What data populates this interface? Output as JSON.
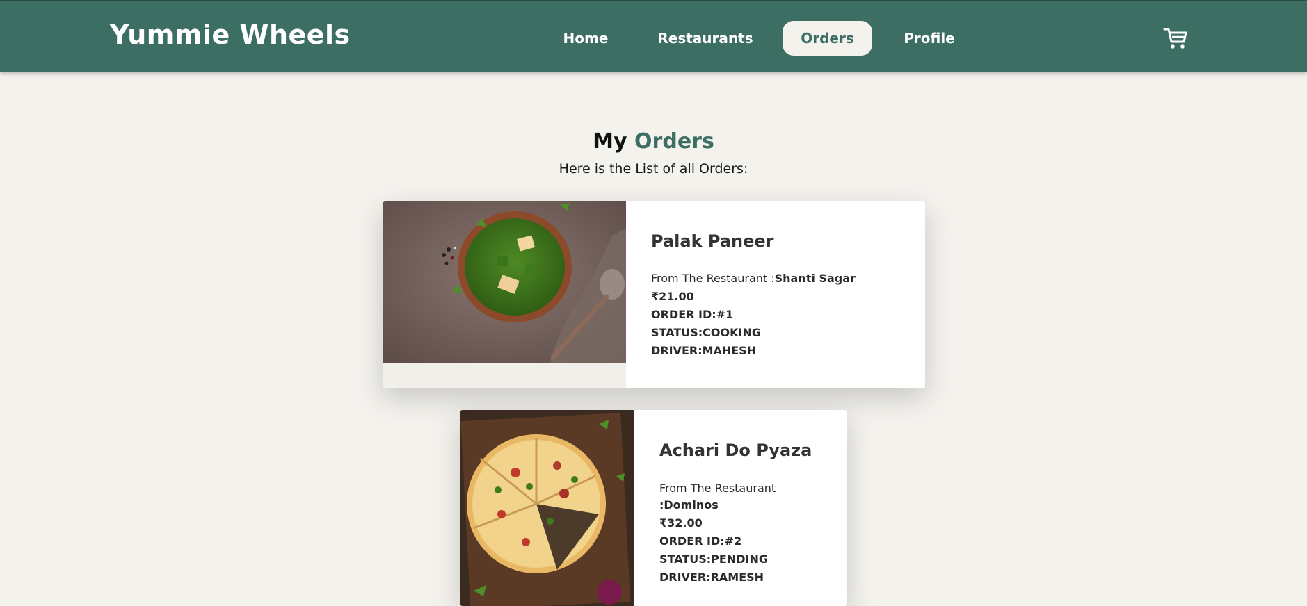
{
  "nav": {
    "brand": "Yummie Wheels",
    "links": [
      "Home",
      "Restaurants",
      "Orders",
      "Profile"
    ],
    "active": "Orders",
    "cart_icon": "cart-icon"
  },
  "header": {
    "title_prefix": "My",
    "title_accent": "Orders",
    "subtitle": "Here is the List of all Orders:"
  },
  "orders": [
    {
      "name": "Palak Paneer",
      "restaurant_label": "From The Restaurant :",
      "restaurant": "Shanti Sagar",
      "price": "₹21.00",
      "order_id": "ORDER ID:#1",
      "status": "STATUS:COOKING",
      "driver": "DRIVER:MAHESH",
      "image": "palak-paneer-bowl-image"
    },
    {
      "name": "Achari Do Pyaza",
      "restaurant_label": "From The Restaurant",
      "restaurant": ":Dominos",
      "price": "₹32.00",
      "order_id": "ORDER ID:#2",
      "status": "STATUS:PENDING",
      "driver": "DRIVER:RAMESH",
      "image": "pizza-board-image"
    }
  ],
  "colors": {
    "primary": "#3d6e64",
    "background": "#f4f2ed",
    "card": "#ffffff"
  }
}
